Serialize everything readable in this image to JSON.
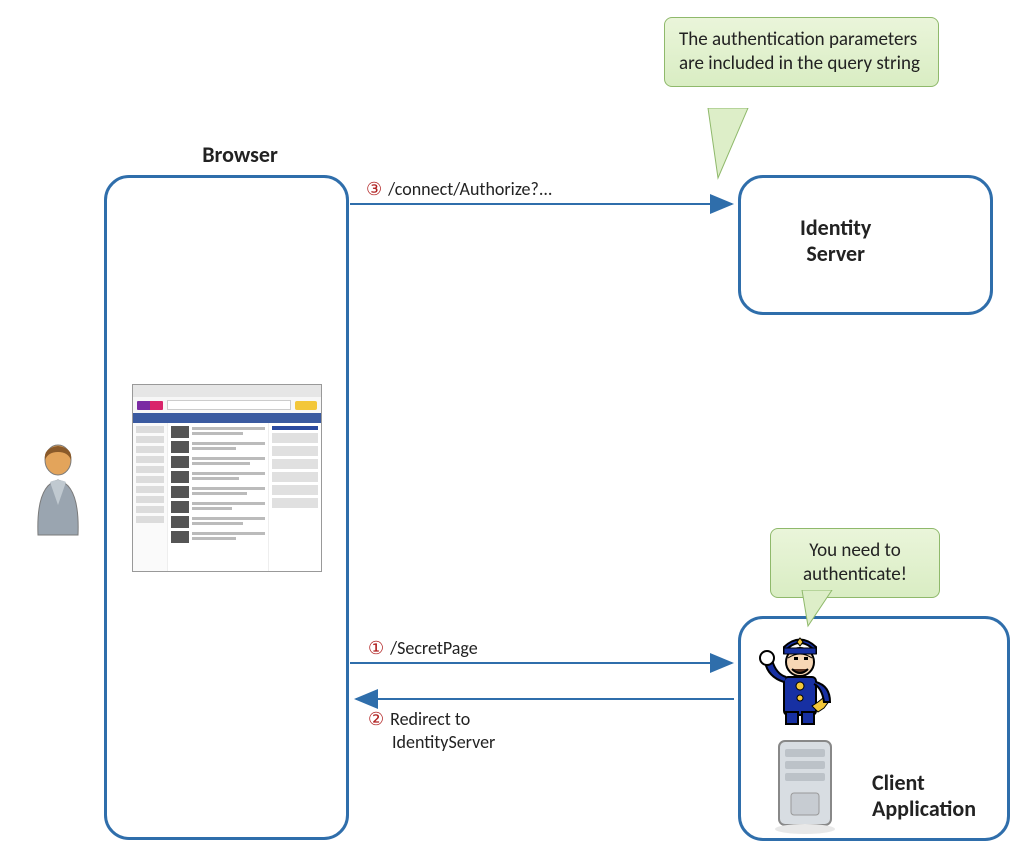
{
  "browser": {
    "title": "Browser"
  },
  "identity_server": {
    "title_line1": "Identity",
    "title_line2": "Server"
  },
  "client_app": {
    "title_line1": "Client",
    "title_line2": "Application"
  },
  "callouts": {
    "auth_params": "The authentication parameters are included in the query string",
    "need_auth": "You need to authenticate!"
  },
  "arrows": {
    "step1": {
      "num": "①",
      "text": "/SecretPage"
    },
    "step2": {
      "num": "②",
      "text": "Redirect to IdentityServer"
    },
    "step3": {
      "num": "③",
      "text": "/connect/Authorize?..."
    }
  }
}
